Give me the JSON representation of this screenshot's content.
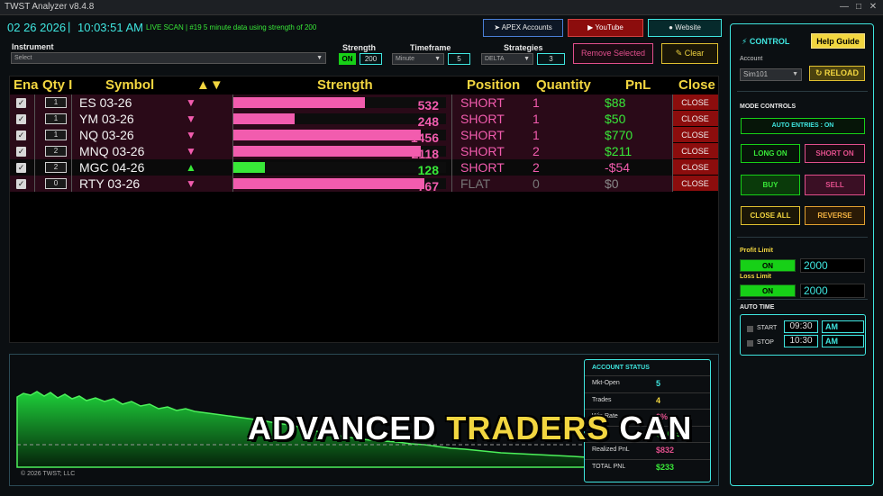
{
  "window": {
    "title": "TWST Analyzer v8.4.8"
  },
  "header": {
    "date": "02 26 2026",
    "separator": "|",
    "time": "10:03:51 AM",
    "scan_text": "LIVE SCAN | #19 5 minute data using strength of 200",
    "apex_label": "APEX Accounts",
    "youtube_label": "YouTube",
    "website_label": "Website"
  },
  "controls": {
    "instrument_label": "Instrument",
    "instrument_placeholder": "Select",
    "strength_label": "Strength",
    "strength_on": "ON",
    "strength_value": "200",
    "timeframe_label": "Timeframe",
    "timeframe_value": "Minute",
    "timeframe_period": "5",
    "strategies_label": "Strategies",
    "strategies_value": "DELTA",
    "strategies_count": "3",
    "remove_label": "Remove Selected",
    "clear_label": "Clear"
  },
  "table": {
    "headers": [
      "Ena",
      "Qty I",
      "Symbol",
      "▲▼",
      "Strength",
      "Position",
      "Quantity",
      "PnL",
      "Close"
    ],
    "close_label": "CLOSE",
    "rows": [
      {
        "qty": "1",
        "symbol": "ES 03-26",
        "dir": "▼",
        "strength": "532",
        "strength_pct": 0.62,
        "position": "SHORT",
        "quantity": "1",
        "pnl": "$88"
      },
      {
        "qty": "1",
        "symbol": "YM 03-26",
        "dir": "▼",
        "strength": "248",
        "strength_pct": 0.29,
        "position": "SHORT",
        "quantity": "1",
        "pnl": "$50"
      },
      {
        "qty": "1",
        "symbol": "NQ 03-26",
        "dir": "▼",
        "strength": "1456",
        "strength_pct": 0.88,
        "position": "SHORT",
        "quantity": "1",
        "pnl": "$770"
      },
      {
        "qty": "2",
        "symbol": "MNQ 03-26",
        "dir": "▼",
        "strength": "2118",
        "strength_pct": 0.88,
        "position": "SHORT",
        "quantity": "2",
        "pnl": "$211"
      },
      {
        "qty": "2",
        "symbol": "MGC 04-26",
        "dir": "▲",
        "strength": "128",
        "strength_pct": 0.15,
        "position": "SHORT",
        "quantity": "2",
        "pnl": "-$54"
      },
      {
        "qty": "0",
        "symbol": "RTY 03-26",
        "dir": "▼",
        "strength": "767",
        "strength_pct": 0.9,
        "position": "FLAT",
        "quantity": "0",
        "pnl": "$0"
      }
    ]
  },
  "footer": {
    "copyright": "© 2026 TWST; LLC"
  },
  "account_status": {
    "title": "ACCOUNT STATUS",
    "rows": [
      {
        "key": "Mkt-Open",
        "value": "5",
        "color": "#3fe6e0"
      },
      {
        "key": "Trades",
        "value": "4",
        "color": "#f2d640"
      },
      {
        "key": "Win Rate",
        "value": "0%",
        "color": "#e24f8c"
      },
      {
        "key": "",
        "value": "$1,065",
        "color": "#38e838"
      },
      {
        "key": "Realized PnL",
        "value": "$832",
        "color": "#e24f8c"
      },
      {
        "key": "TOTAL PNL",
        "value": "$233",
        "color": "#38e838"
      }
    ]
  },
  "overlay": {
    "word1": "ADVANCED",
    "word2": "TRADERS",
    "word3": "CAN"
  },
  "panel": {
    "title": "CONTROL",
    "help_label": "Help Guide",
    "account_label": "Account",
    "account_value": "Sim101",
    "reload_label": "RELOAD",
    "mode_label": "MODE CONTROLS",
    "auto_entries": "AUTO ENTRIES : ON",
    "long_on": "LONG ON",
    "short_on": "SHORT ON",
    "buy": "BUY",
    "sell": "SELL",
    "close_all": "CLOSE ALL",
    "reverse": "REVERSE",
    "profit_label": "Profit Limit",
    "profit_on": "ON",
    "profit_value": "2000",
    "loss_label": "Loss Limit",
    "loss_on": "ON",
    "loss_value": "2000",
    "auto_time_label": "AUTO TIME",
    "start_label": "START",
    "start_time": "09:30",
    "start_ampm": "AM",
    "stop_label": "STOP",
    "stop_time": "10:30",
    "stop_ampm": "AM"
  },
  "colors": {
    "accent": "#3fe6e0",
    "pink": "#f25cae",
    "green": "#38e838",
    "yellow": "#f2d640",
    "red": "#8c0d0d"
  }
}
